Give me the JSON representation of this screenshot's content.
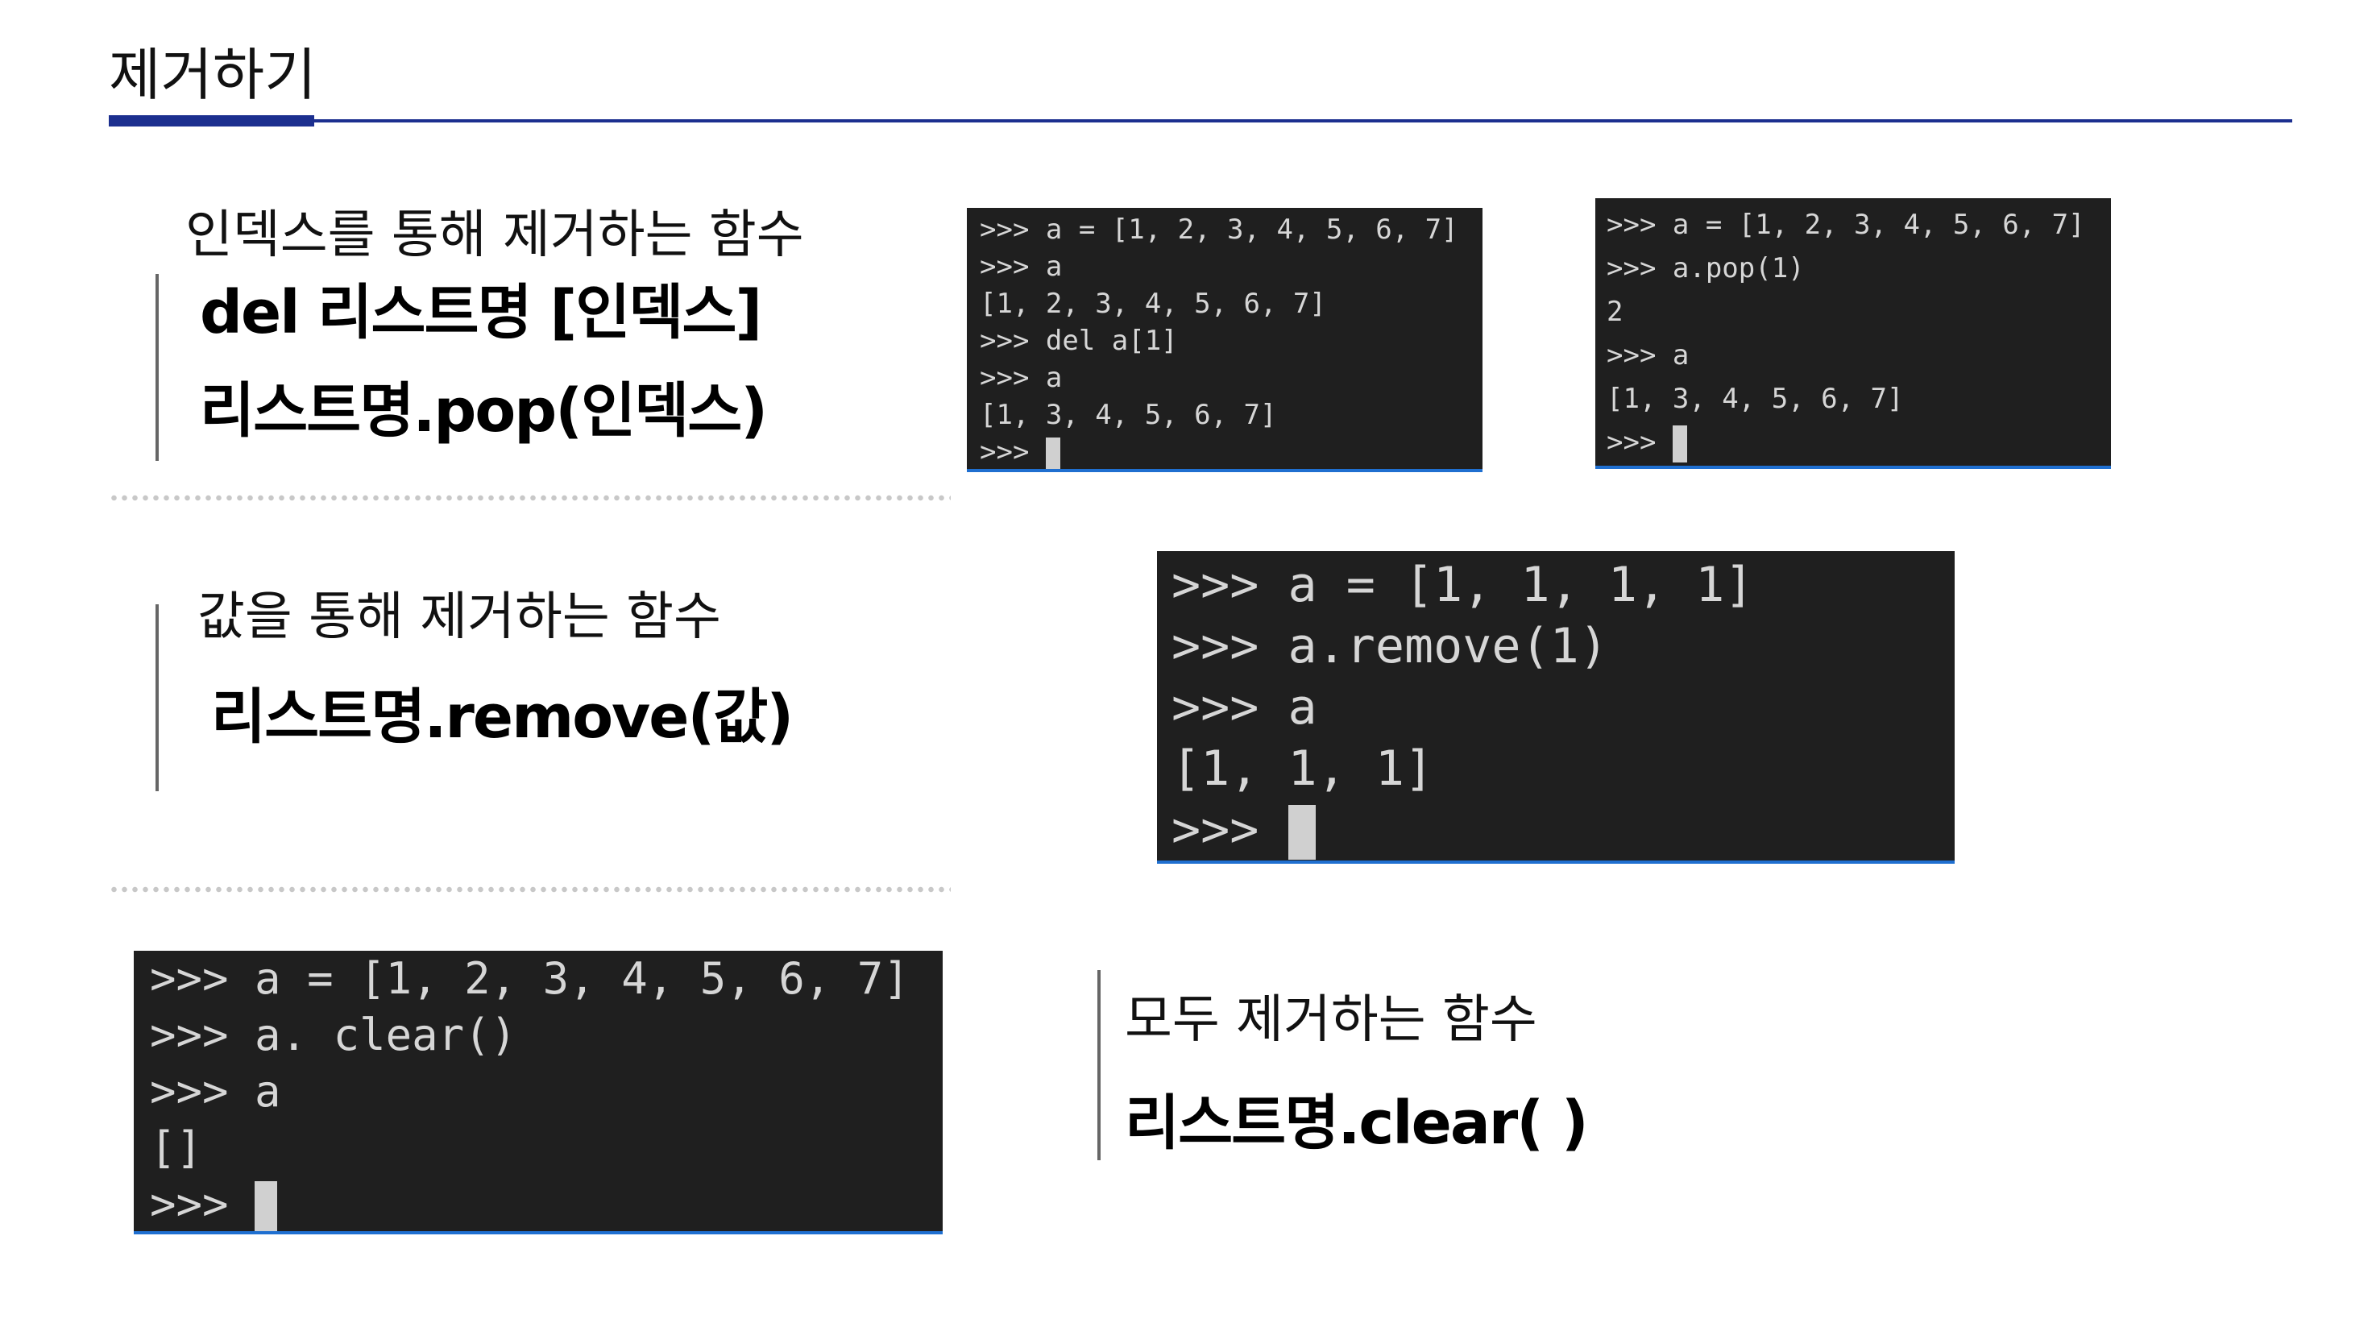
{
  "slide": {
    "title": "제거하기"
  },
  "sections": [
    {
      "description": "인덱스를 통해 제거하는 함수",
      "syntax": [
        "del 리스트명 [인덱스]",
        "리스트명.pop(인덱스)"
      ]
    },
    {
      "description": "값을 통해 제거하는 함수",
      "syntax": [
        "리스트명.remove(값)"
      ]
    },
    {
      "description": "모두 제거하는 함수",
      "syntax": [
        "리스트명.clear( )"
      ]
    }
  ],
  "terminals": {
    "del_example": {
      "lines": [
        ">>> a = [1, 2, 3, 4, 5, 6, 7]",
        ">>> a",
        "[1, 2, 3, 4, 5, 6, 7]",
        ">>> del a[1]",
        ">>> a",
        "[1, 3, 4, 5, 6, 7]",
        ">>> "
      ]
    },
    "pop_example": {
      "lines": [
        ">>> a = [1, 2, 3, 4, 5, 6, 7]",
        ">>> a.pop(1)",
        "2",
        ">>> a",
        "[1, 3, 4, 5, 6, 7]",
        ">>> "
      ]
    },
    "remove_example": {
      "lines": [
        ">>> a = [1, 1, 1, 1]",
        ">>> a.remove(1)",
        ">>> a",
        "[1, 1, 1]",
        ">>> "
      ]
    },
    "clear_example": {
      "lines": [
        ">>> a = [1, 2, 3, 4, 5, 6, 7]",
        ">>> a. clear()",
        ">>> a",
        "[]",
        ">>> "
      ]
    }
  },
  "colors": {
    "accent": "#1c2f8f",
    "terminal_bg": "#1f1f1f",
    "terminal_text": "#d6d6d6",
    "terminal_border": "#1f6fd0"
  }
}
